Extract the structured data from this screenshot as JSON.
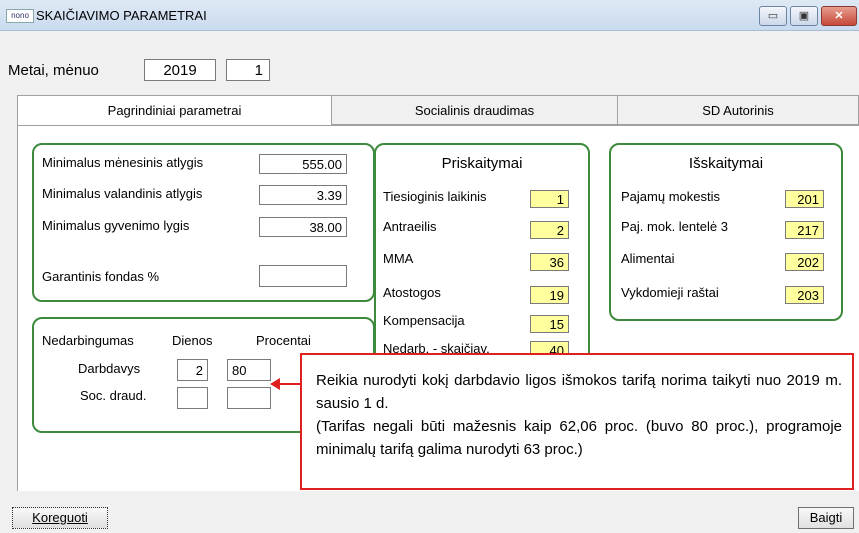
{
  "window": {
    "logo": "nono",
    "title": "SKAIČIAVIMO PARAMETRAI",
    "minimize": "▭",
    "maximize": "▣",
    "close": "✕"
  },
  "period": {
    "label": "Metai, mėnuo",
    "year": "2019",
    "month": "1"
  },
  "tabs": [
    {
      "label": "Pagrindiniai parametrai",
      "active": true
    },
    {
      "label": "Socialinis draudimas",
      "active": false
    },
    {
      "label": "SD Autorinis",
      "active": false
    }
  ],
  "params": {
    "min_monthly_label": "Minimalus mėnesinis atlygis",
    "min_monthly_value": "555.00",
    "min_hourly_label": "Minimalus valandinis atlygis",
    "min_hourly_value": "3.39",
    "min_living_label": "Minimalus gyvenimo lygis",
    "min_living_value": "38.00",
    "guarantee_label": "Garantinis fondas %",
    "guarantee_value": ""
  },
  "sick": {
    "header_label": "Nedarbingumas",
    "days_header": "Dienos",
    "percent_header": "Procentai",
    "employer_label": "Darbdavys",
    "employer_days": "2",
    "employer_percent": "80",
    "soc_label": "Soc. draud.",
    "soc_days": "",
    "soc_percent": ""
  },
  "accruals": {
    "title": "Priskaitymai",
    "items": [
      {
        "label": "Tiesioginis laikinis",
        "value": "1"
      },
      {
        "label": "Antraeilis",
        "value": "2"
      },
      {
        "label": "MMA",
        "value": "36"
      },
      {
        "label": "Atostogos",
        "value": "19"
      },
      {
        "label": "Kompensacija",
        "value": "15"
      },
      {
        "label": "Nedarb. - skaičiav.",
        "value": "40"
      }
    ]
  },
  "deductions": {
    "title": "Išskaitymai",
    "items": [
      {
        "label": "Pajamų mokestis",
        "value": "201"
      },
      {
        "label": "Paj. mok. lentelė 3",
        "value": "217"
      },
      {
        "label": "Alimentai",
        "value": "202"
      },
      {
        "label": "Vykdomieji raštai",
        "value": "203"
      }
    ]
  },
  "callout": {
    "line1": "Reikia nurodyti kokį darbdavio ligos išmokos tarifą norima taikyti nuo  2019 m. sausio 1 d.",
    "line2": "(Tarifas negali būti mažesnis kaip 62,06 proc. (buvo 80 proc.), programoje minimalų tarifą galima nurodyti 63 proc.)"
  },
  "buttons": {
    "edit": "Koreguoti",
    "finish": "Baigti"
  },
  "colors": {
    "group_border": "#3d8a3d",
    "callout_border": "#e02020",
    "highlight_field": "#ffff9e"
  }
}
